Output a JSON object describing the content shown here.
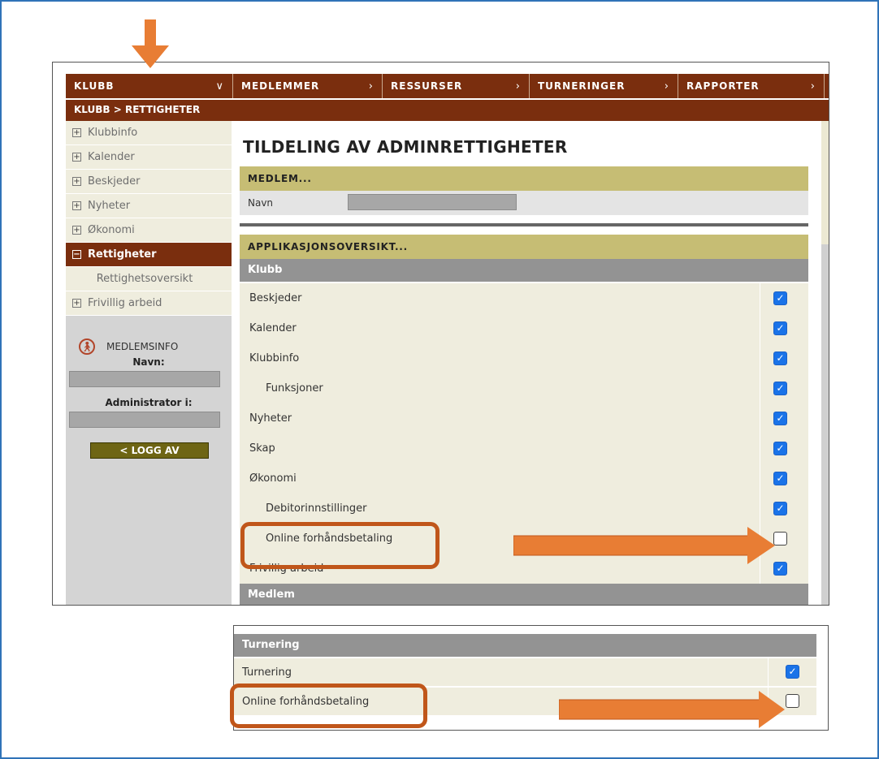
{
  "nav": {
    "items": [
      {
        "label": "KLUBB",
        "chevron": "chevron-down-icon"
      },
      {
        "label": "MEDLEMMER",
        "chevron": "chevron-right-icon"
      },
      {
        "label": "RESSURSER",
        "chevron": "chevron-right-icon"
      },
      {
        "label": "TURNERINGER",
        "chevron": "chevron-right-icon"
      },
      {
        "label": "RAPPORTER",
        "chevron": "chevron-right-icon"
      }
    ]
  },
  "breadcrumb": "KLUBB > RETTIGHETER",
  "sidebar": {
    "items": [
      {
        "label": "Klubbinfo",
        "state": "collapsed"
      },
      {
        "label": "Kalender",
        "state": "collapsed"
      },
      {
        "label": "Beskjeder",
        "state": "collapsed"
      },
      {
        "label": "Nyheter",
        "state": "collapsed"
      },
      {
        "label": "Økonomi",
        "state": "collapsed"
      },
      {
        "label": "Rettigheter",
        "state": "expanded"
      },
      {
        "label": "Rettighetsoversikt",
        "state": "child"
      },
      {
        "label": "Frivillig arbeid",
        "state": "collapsed"
      }
    ],
    "memberinfo": {
      "title": "MEDLEMSINFO",
      "name_label": "Navn:",
      "admin_label": "Administrator i:",
      "logout_label": "< LOGG AV"
    }
  },
  "main": {
    "title": "TILDELING AV ADMINRETTIGHETER",
    "member_section": "MEDLEM...",
    "name_field_label": "Navn",
    "app_section": "APPLIKASJONSOVERSIKT...",
    "klubb_group": "Klubb",
    "permissions": [
      {
        "label": "Beskjeder",
        "checked": true,
        "indent": false
      },
      {
        "label": "Kalender",
        "checked": true,
        "indent": false
      },
      {
        "label": "Klubbinfo",
        "checked": true,
        "indent": false
      },
      {
        "label": "Funksjoner",
        "checked": true,
        "indent": true
      },
      {
        "label": "Nyheter",
        "checked": true,
        "indent": false
      },
      {
        "label": "Skap",
        "checked": true,
        "indent": false
      },
      {
        "label": "Økonomi",
        "checked": true,
        "indent": false
      },
      {
        "label": "Debitorinnstillinger",
        "checked": true,
        "indent": true
      },
      {
        "label": "Online forhåndsbetaling",
        "checked": false,
        "indent": true
      },
      {
        "label": "Frivillig arbeid",
        "checked": true,
        "indent": false
      }
    ],
    "next_group": "Medlem"
  },
  "turnering": {
    "group": "Turnering",
    "permissions": [
      {
        "label": "Turnering",
        "checked": true
      },
      {
        "label": "Online forhåndsbetaling",
        "checked": false
      }
    ]
  },
  "colors": {
    "brand": "#7a2e0e",
    "section": "#c6bd74",
    "checkbox": "#1a73e8",
    "annotation": "#e87d34"
  }
}
